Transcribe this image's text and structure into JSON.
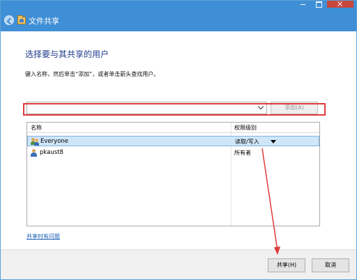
{
  "window": {
    "title": "文件共享",
    "accent_color": "#3f8fd6",
    "controls": [
      "minimize-icon",
      "maximize-icon",
      "close-icon"
    ]
  },
  "dialog": {
    "heading": "选择要与其共享的用户",
    "instruction": "键入名称，然后单击“添加”，或者单击箭头查找用户。",
    "name_input": {
      "value": "",
      "placeholder": ""
    },
    "add_button": "添加(A)"
  },
  "list": {
    "columns": [
      "名称",
      "权限级别"
    ],
    "rows": [
      {
        "name": "Everyone",
        "permission": "读取/写入",
        "icon": "group-icon",
        "selected": true
      },
      {
        "name": "pkaust8",
        "permission": "所有者",
        "icon": "user-icon",
        "selected": false
      }
    ]
  },
  "help_link": "共享时有问题",
  "footer": {
    "share_button": "共享(H)",
    "cancel_button": "取消"
  },
  "annotation": {
    "highlight_color": "#e03a3a"
  }
}
